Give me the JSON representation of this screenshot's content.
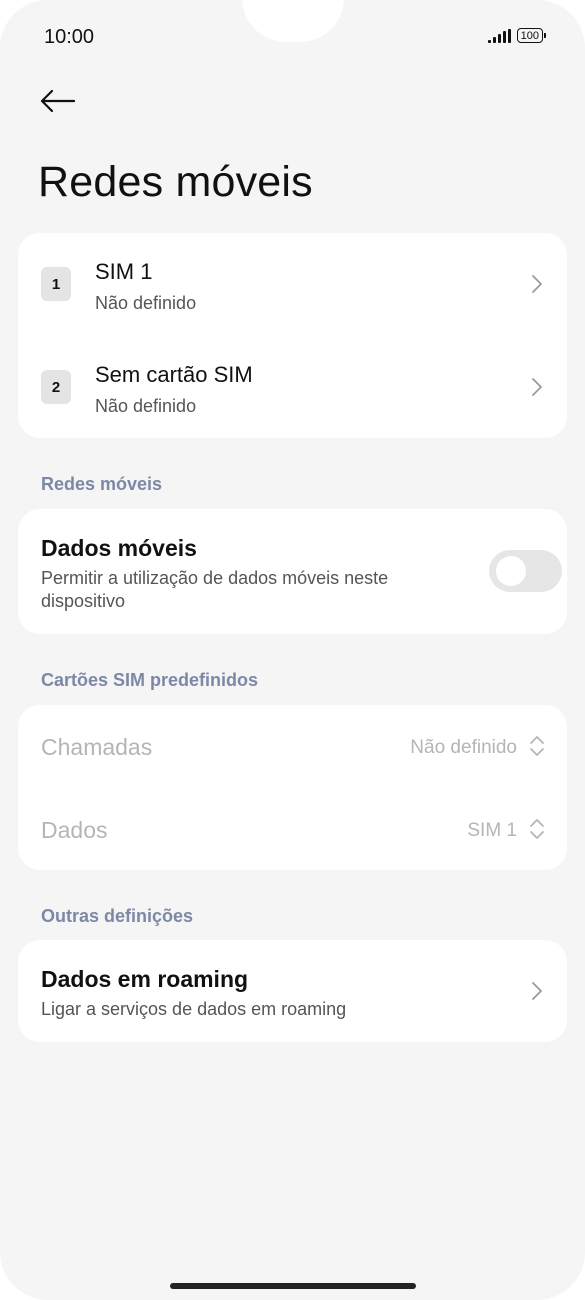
{
  "status_bar": {
    "time": "10:00",
    "battery": "100",
    "icons": [
      "signal-icon",
      "battery-icon"
    ]
  },
  "header": {
    "back_icon": "arrow-left-icon",
    "title": "Redes móveis"
  },
  "sim_cards": [
    {
      "badge": "1",
      "title": "SIM 1",
      "subtitle": "Não definido"
    },
    {
      "badge": "2",
      "title": "Sem cartão SIM",
      "subtitle": "Não definido"
    }
  ],
  "mobile_networks": {
    "section_label": "Redes móveis",
    "mobile_data": {
      "title": "Dados móveis",
      "description": "Permitir a utilização de dados móveis neste dispositivo",
      "enabled": false
    }
  },
  "default_sims": {
    "section_label": "Cartões SIM predefinidos",
    "calls": {
      "label": "Chamadas",
      "value": "Não definido"
    },
    "data": {
      "label": "Dados",
      "value": "SIM 1"
    }
  },
  "other_settings": {
    "section_label": "Outras definições",
    "roaming": {
      "title": "Dados em roaming",
      "subtitle": "Ligar a serviços de dados em roaming"
    }
  },
  "colors": {
    "background": "#f5f5f5",
    "card": "#ffffff",
    "section_label": "#7c88a6",
    "disabled_text": "#b5b5b5",
    "toggle_off": "#e6e6e6"
  }
}
